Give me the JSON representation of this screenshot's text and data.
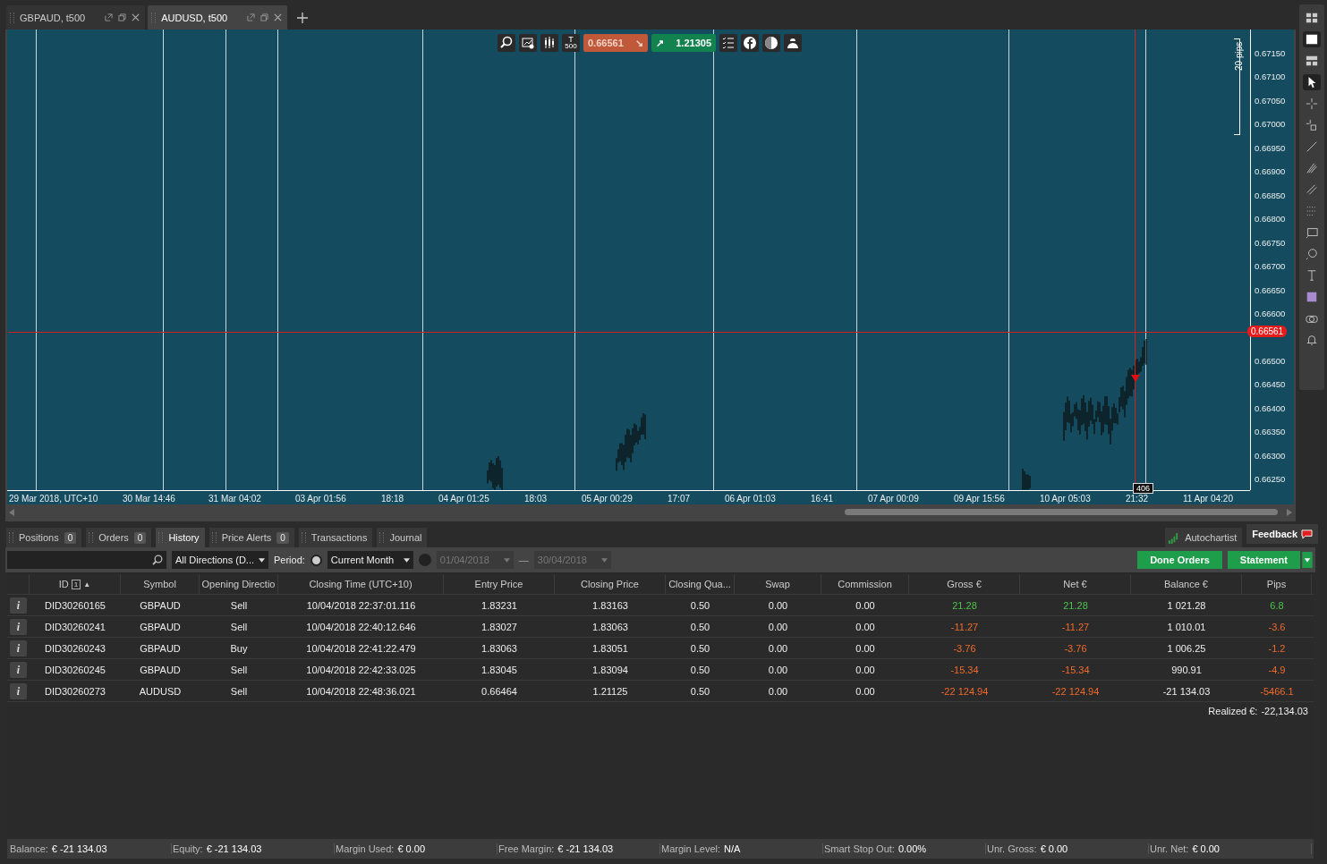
{
  "chart_tabs": [
    {
      "label": "GBPAUD, t500",
      "selected": false
    },
    {
      "label": "AUDUSD, t500",
      "selected": true
    }
  ],
  "chart": {
    "sell_price": "0.66561",
    "buy_price": "1.21305",
    "sell_arrow": "↘",
    "buy_arrow": "↗",
    "tick_letter": "T",
    "tick_badge": "500",
    "range_label": "20 pips",
    "current_price": "0.66561",
    "crosshair_time": "406",
    "price_labels": [
      "0.67150",
      "0.67100",
      "0.67050",
      "0.67000",
      "0.66950",
      "0.66900",
      "0.66850",
      "0.66800",
      "0.66750",
      "0.66700",
      "0.66650",
      "0.66600",
      "0.66500",
      "0.66450",
      "0.66400",
      "0.66350",
      "0.66300",
      "0.66250"
    ],
    "time_labels": [
      "29 Mar 2018, UTC+10",
      "30 Mar 14:46",
      "31 Mar 04:02",
      "03 Apr 01:56",
      "18:18",
      "04 Apr 01:25",
      "18:03",
      "05 Apr 00:29",
      "17:07",
      "06 Apr 01:03",
      "16:41",
      "07 Apr 00:09",
      "09 Apr 15:56",
      "10 Apr 05:03",
      "21:32",
      "11 Apr 04:20"
    ]
  },
  "side_tools": [
    {
      "kind": "grid",
      "selected": false
    },
    {
      "kind": "single",
      "selected": true
    },
    {
      "kind": "split",
      "selected": false
    },
    {
      "kind": "cursor",
      "selected": true
    },
    {
      "kind": "cross",
      "selected": false
    },
    {
      "kind": "crossbox",
      "selected": false
    },
    {
      "kind": "line",
      "selected": false
    },
    {
      "kind": "fan",
      "selected": false
    },
    {
      "kind": "channel",
      "selected": false
    },
    {
      "kind": "dots",
      "selected": false
    },
    {
      "kind": "rect",
      "selected": false
    },
    {
      "kind": "circle",
      "selected": false
    },
    {
      "kind": "text",
      "selected": false
    },
    {
      "kind": "swatch",
      "selected": false
    },
    {
      "kind": "camera",
      "selected": false
    },
    {
      "kind": "bell",
      "selected": false
    }
  ],
  "panel_tabs": [
    {
      "label": "Positions",
      "count": "0",
      "selected": false
    },
    {
      "label": "Orders",
      "count": "0",
      "selected": false
    },
    {
      "label": "History",
      "selected": true
    },
    {
      "label": "Price Alerts",
      "count": "0",
      "selected": false
    },
    {
      "label": "Transactions",
      "selected": false
    },
    {
      "label": "Journal",
      "selected": false
    }
  ],
  "autochartist": "Autochartist",
  "feedback": "Feedback",
  "filters": {
    "direction": "All Directions (D...",
    "period_label": "Period:",
    "period_preset_selected": true,
    "period": "Current Month",
    "date_from": "01/04/2018",
    "date_separator": "—",
    "date_to": "30/04/2018",
    "dates_disabled": true
  },
  "buttons": {
    "done_orders": "Done Orders",
    "statement": "Statement"
  },
  "table": {
    "sort_index": "1",
    "sort_arrow": "▲",
    "columns": [
      "ID",
      "Symbol",
      "Opening Directio",
      "Closing Time (UTC+10)",
      "Entry Price",
      "Closing Price",
      "Closing Qua...",
      "Swap",
      "Commission",
      "Gross €",
      "Net €",
      "Balance €",
      "Pips"
    ],
    "rows": [
      {
        "info": "i",
        "profit": true,
        "cells": [
          "DID30260165",
          "GBPAUD",
          "Sell",
          "10/04/2018 22:37:01.116",
          "1.83231",
          "1.83163",
          "0.50",
          "0.00",
          "0.00",
          "21.28",
          "21.28",
          "1 021.28",
          "6.8"
        ]
      },
      {
        "info": "i",
        "profit": false,
        "cells": [
          "DID30260241",
          "GBPAUD",
          "Sell",
          "10/04/2018 22:40:12.646",
          "1.83027",
          "1.83063",
          "0.50",
          "0.00",
          "0.00",
          "-11.27",
          "-11.27",
          "1 010.01",
          "-3.6"
        ]
      },
      {
        "info": "i",
        "profit": false,
        "cells": [
          "DID30260243",
          "GBPAUD",
          "Buy",
          "10/04/2018 22:41:22.479",
          "1.83063",
          "1.83051",
          "0.50",
          "0.00",
          "0.00",
          "-3.76",
          "-3.76",
          "1 006.25",
          "-1.2"
        ]
      },
      {
        "info": "i",
        "profit": false,
        "cells": [
          "DID30260245",
          "GBPAUD",
          "Sell",
          "10/04/2018 22:42:33.025",
          "1.83045",
          "1.83094",
          "0.50",
          "0.00",
          "0.00",
          "-15.34",
          "-15.34",
          "990.91",
          "-4.9"
        ]
      },
      {
        "info": "i",
        "profit": false,
        "cells": [
          "DID30260273",
          "AUDUSD",
          "Sell",
          "10/04/2018 22:48:36.021",
          "0.66464",
          "1.21125",
          "0.50",
          "0.00",
          "0.00",
          "-22 124.94",
          "-22 124.94",
          "-21 134.03",
          "-5466.1"
        ]
      }
    ],
    "realized_label": "Realized €:",
    "realized_value": "-22,134.03"
  },
  "status_bar": [
    {
      "label": "Balance:",
      "value": "€ -21 134.03"
    },
    {
      "label": "Equity:",
      "value": "€ -21 134.03"
    },
    {
      "label": "Margin Used:",
      "value": "€ 0.00"
    },
    {
      "label": "Free Margin:",
      "value": "€ -21 134.03"
    },
    {
      "label": "Margin Level:",
      "value": "N/A"
    },
    {
      "label": "Smart Stop Out:",
      "value": "0.00%"
    },
    {
      "label": "Unr. Gross:",
      "value": "€ 0.00"
    },
    {
      "label": "Unr. Net:",
      "value": "€ 0.00"
    }
  ]
}
